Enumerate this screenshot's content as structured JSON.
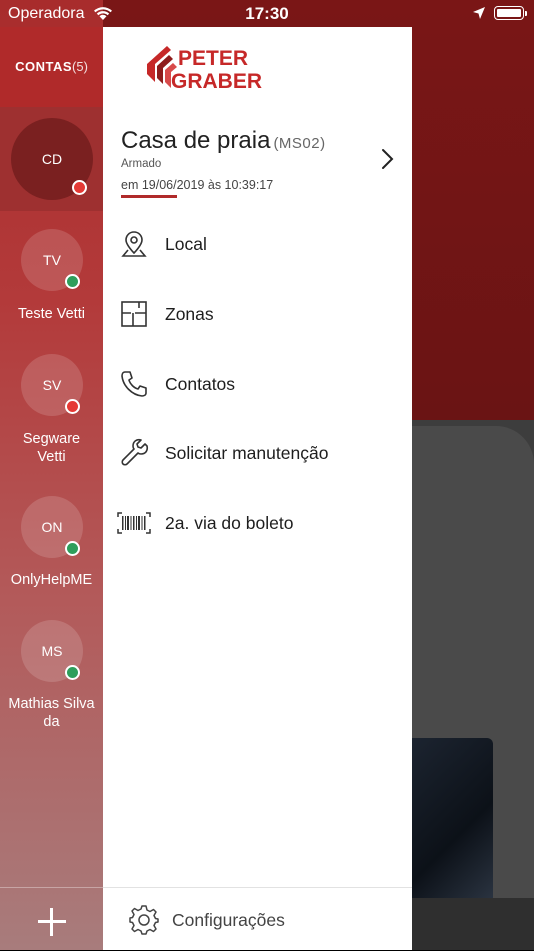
{
  "status_bar": {
    "carrier": "Operadora",
    "time": "17:30"
  },
  "accounts_header": {
    "label": "CONTAS",
    "count": "(5)"
  },
  "accounts": [
    {
      "initials": "CD",
      "name": "",
      "status_color": "#e53935",
      "selected": true
    },
    {
      "initials": "TV",
      "name": "Teste Vetti",
      "status_color": "#2e9e5b"
    },
    {
      "initials": "SV",
      "name": "Segware Vetti",
      "status_color": "#e53935"
    },
    {
      "initials": "ON",
      "name": "OnlyHelpME",
      "status_color": "#2e9e5b"
    },
    {
      "initials": "MS",
      "name": "Mathias Silva da",
      "status_color": "#2e9e5b"
    }
  ],
  "brand": {
    "line1": "PETER",
    "line2": "GRABER"
  },
  "site": {
    "name": "Casa de praia",
    "code": "(MS02)",
    "status": "Armado",
    "date": "em 19/06/2019 às 10:39:17"
  },
  "menu": [
    {
      "label": "Local",
      "icon": "map-pin-icon"
    },
    {
      "label": "Zonas",
      "icon": "floor-plan-icon"
    },
    {
      "label": "Contatos",
      "icon": "phone-icon"
    },
    {
      "label": "Solicitar manutenção",
      "icon": "wrench-icon"
    },
    {
      "label": "2a. via do boleto",
      "icon": "barcode-icon"
    }
  ],
  "footer": {
    "settings_label": "Configurações",
    "icon": "gear-icon"
  },
  "colors": {
    "accent": "#b02a2a",
    "alarm_red": "#e53935",
    "ok_green": "#2e9e5b"
  }
}
